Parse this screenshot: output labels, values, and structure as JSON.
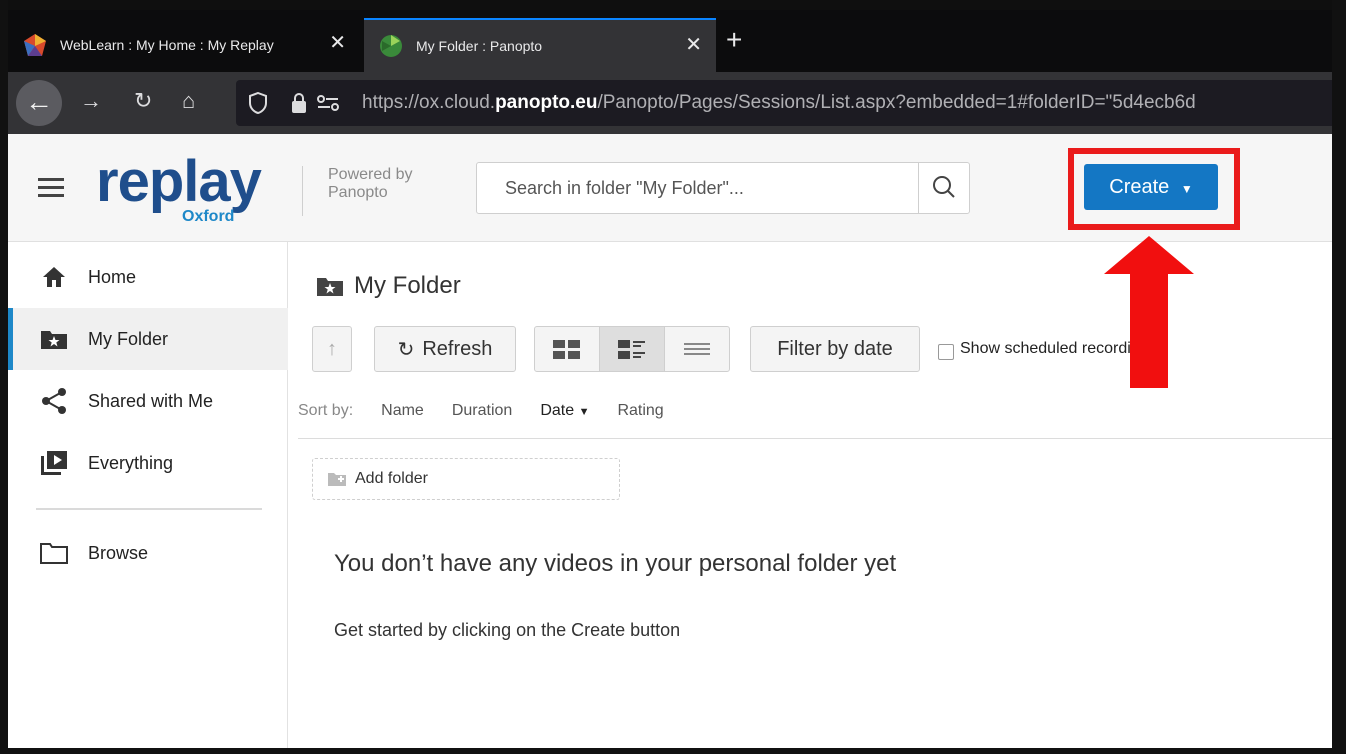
{
  "browser": {
    "tabs": [
      {
        "title": "WebLearn : My Home : My Replay",
        "active": false
      },
      {
        "title": "My Folder : Panopto",
        "active": true
      }
    ],
    "url_prefix": "https://ox.cloud.",
    "url_domain": "panopto.eu",
    "url_suffix": "/Panopto/Pages/Sessions/List.aspx?embedded=1#folderID=\"5d4ecb6d",
    "accent": "#0a84ff"
  },
  "header": {
    "logo_main": "replay",
    "logo_sub": "Oxford",
    "powered_by": "Powered by Panopto",
    "search_placeholder": "Search in folder \"My Folder\"...",
    "create_label": "Create",
    "create_color": "#1477c4",
    "highlight_color": "#ea1b1b"
  },
  "sidebar": {
    "items": [
      {
        "label": "Home",
        "icon": "home-icon"
      },
      {
        "label": "My Folder",
        "icon": "star-folder-icon",
        "active": true
      },
      {
        "label": "Shared with Me",
        "icon": "share-icon"
      },
      {
        "label": "Everything",
        "icon": "play-library-icon"
      },
      {
        "label": "Browse",
        "icon": "folder-icon"
      }
    ],
    "accent": "#1e88c8"
  },
  "main": {
    "title": "My Folder",
    "toolbar": {
      "refresh_label": "Refresh",
      "filter_label": "Filter by date",
      "show_scheduled_label": "Show scheduled recordings"
    },
    "sort": {
      "label": "Sort by:",
      "options": [
        "Name",
        "Duration",
        "Date",
        "Rating"
      ],
      "active": "Date"
    },
    "add_folder_label": "Add folder",
    "empty_title": "You don’t have any videos in your personal folder yet",
    "empty_subtitle": "Get started by clicking on the Create button"
  }
}
